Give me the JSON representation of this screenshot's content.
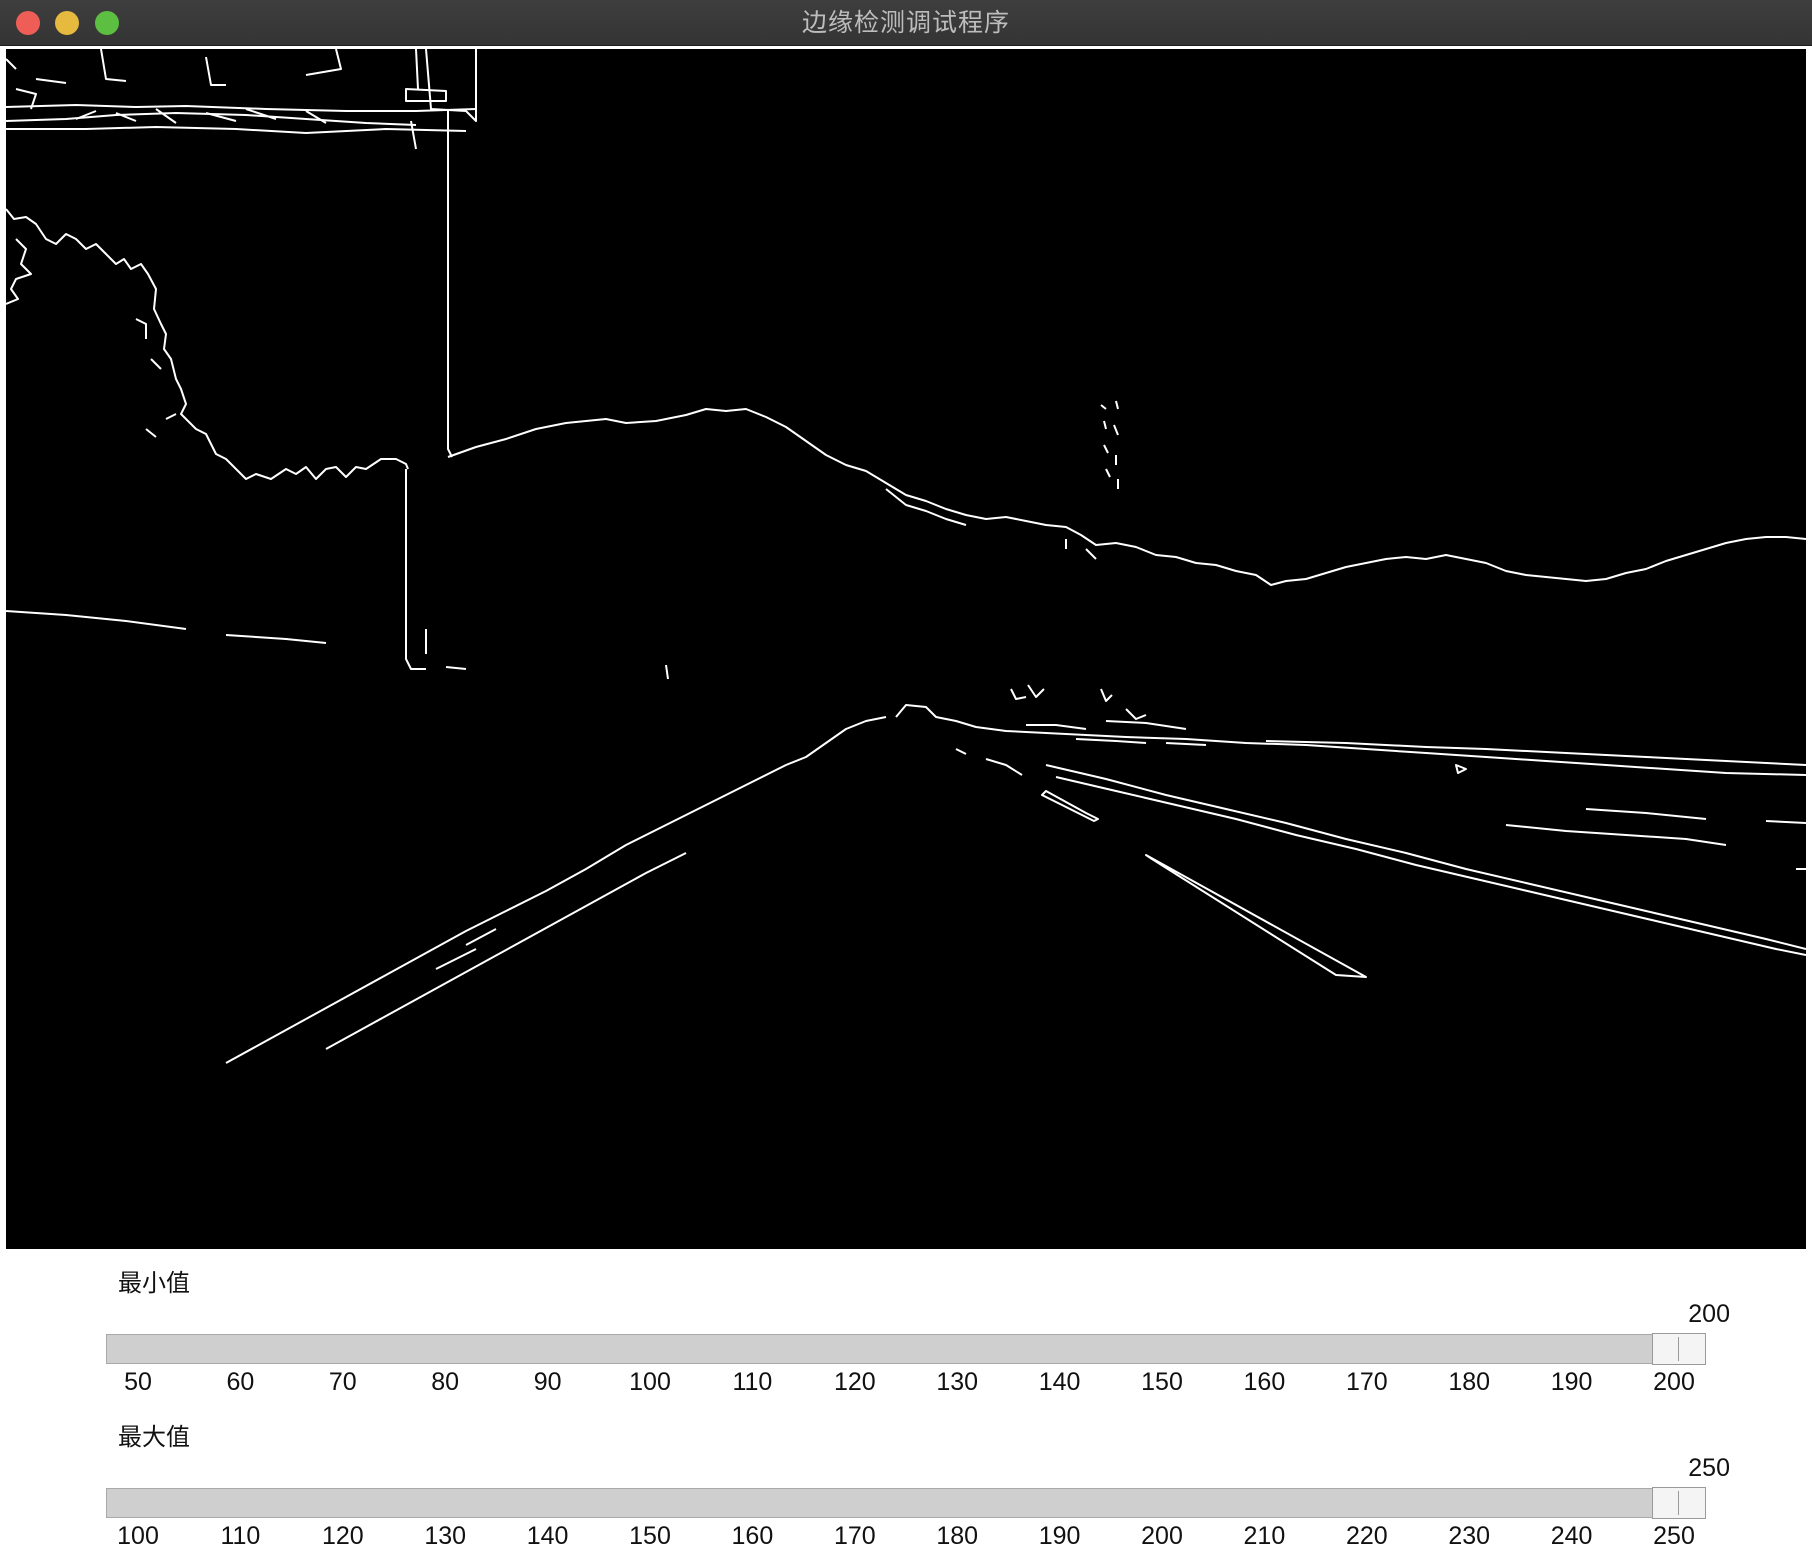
{
  "window": {
    "title": "边缘检测调试程序"
  },
  "image": {
    "description_icon": "canny-edge-output"
  },
  "sliders": [
    {
      "label": "最小值",
      "min": 50,
      "max": 200,
      "value": 200,
      "value_text": "200",
      "ticks": [
        "50",
        "60",
        "70",
        "80",
        "90",
        "100",
        "110",
        "120",
        "130",
        "140",
        "150",
        "160",
        "170",
        "180",
        "190",
        "200"
      ]
    },
    {
      "label": "最大值",
      "min": 100,
      "max": 250,
      "value": 250,
      "value_text": "250",
      "ticks": [
        "100",
        "110",
        "120",
        "130",
        "140",
        "150",
        "160",
        "170",
        "180",
        "190",
        "200",
        "210",
        "220",
        "230",
        "240",
        "250"
      ]
    }
  ],
  "colors": {
    "titlebar": "#383838",
    "close": "#ee5e56",
    "minimize": "#e6ba3e",
    "maximize": "#5dbf42",
    "edges": "#ffffff",
    "image_bg": "#000000",
    "track": "#cfcfcf"
  }
}
